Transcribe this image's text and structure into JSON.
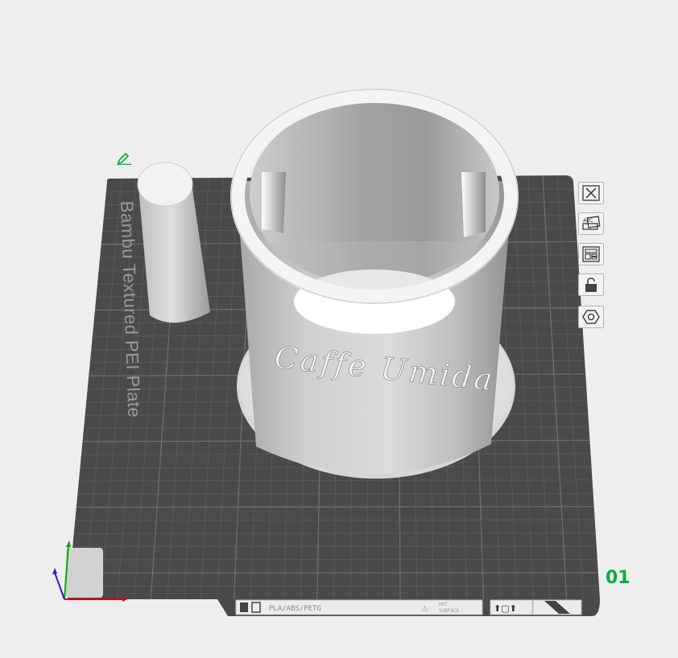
{
  "plate": {
    "label": "Bambu Textured PEI Plate",
    "number": "01",
    "filament_label": "PLA/ABS/PETG",
    "surface_label_line1": "HOT",
    "surface_label_line2": "SURFACE"
  },
  "model": {
    "engraved_text": "Caffe Umida"
  },
  "toolbar": {
    "items": [
      {
        "name": "close-icon"
      },
      {
        "name": "pick-object-icon"
      },
      {
        "name": "arrange-icon"
      },
      {
        "name": "lock-icon"
      },
      {
        "name": "settings-hex-icon"
      }
    ]
  },
  "colors": {
    "accent": "#00ae42",
    "plate": "#4a4a4a",
    "grid": "#5e5e5e",
    "model": "#d0d0d0"
  }
}
